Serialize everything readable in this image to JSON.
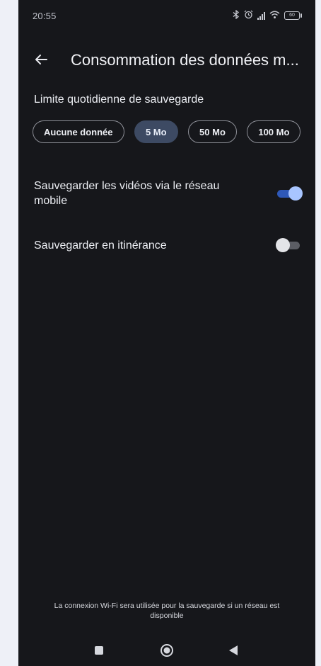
{
  "status_bar": {
    "time": "20:55",
    "battery_level": "60"
  },
  "header": {
    "back_icon": "arrow-left-icon",
    "title": "Consommation des données m..."
  },
  "daily_limit": {
    "label": "Limite quotidienne de sauvegarde",
    "options": [
      "Aucune donnée",
      "5 Mo",
      "50 Mo",
      "100 Mo"
    ],
    "selected": "5 Mo"
  },
  "settings": [
    {
      "label": "Sauvegarder les vidéos via le réseau mobile",
      "enabled": true
    },
    {
      "label": "Sauvegarder en itinérance",
      "enabled": false
    }
  ],
  "footer": {
    "note": "La connexion Wi-Fi sera utilisée pour la sauvegarde si un réseau est disponible"
  },
  "colors": {
    "background": "#16171b",
    "accent": "#a8c5ff",
    "selected_chip": "#3d4a63"
  },
  "navigation": {
    "icons": [
      "recent-apps-icon",
      "home-icon",
      "back-triangle-icon"
    ]
  }
}
